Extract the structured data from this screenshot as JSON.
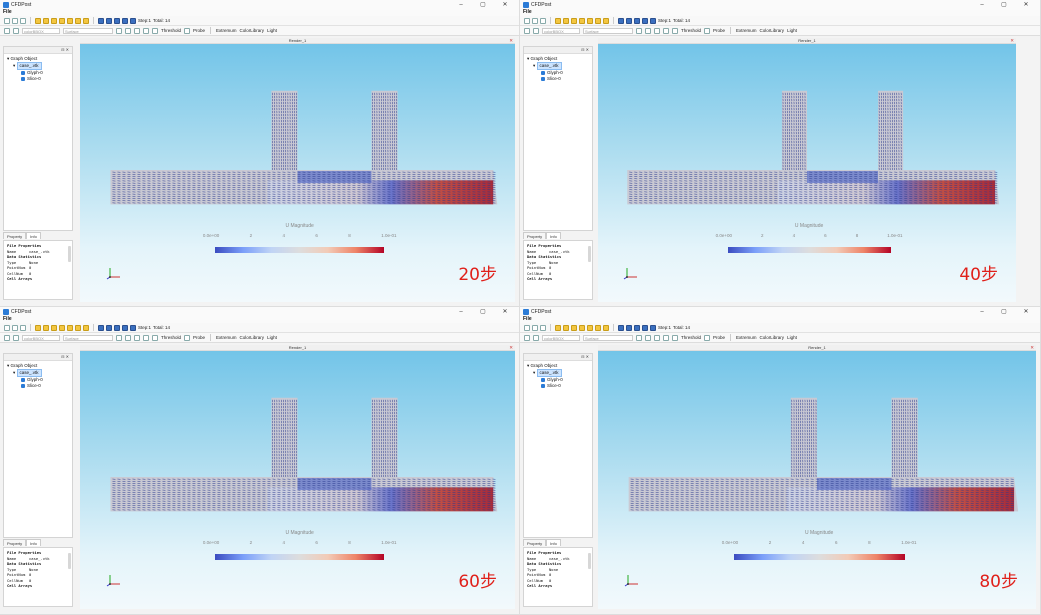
{
  "app": {
    "title": "CFDPost",
    "menu": "File",
    "window_buttons": [
      "–",
      "▢",
      "✕"
    ]
  },
  "toolbar": {
    "step_label": "Step:1",
    "total_label": "Total: 14",
    "threshold_label": "Threshold",
    "probe_label": "Probe",
    "extremum_label": "Extremum",
    "colorlibrary_label": "ColorLibrary",
    "light_label": "Light",
    "search_placeholder": "colorBBOX",
    "surface_placeholder": "Surface"
  },
  "panel": {
    "tree_root": "Graph Object",
    "tree_file": "case_.vtk",
    "tree_items": [
      "Glyph-0",
      "Slice-0"
    ],
    "tabs": [
      "Property",
      "Info"
    ],
    "props": {
      "section1": "File Properties",
      "name_key": "Name",
      "name_val": "case_.vtk",
      "section2": "Data Statistics",
      "type_key": "Type",
      "type_val": "None",
      "points_key": "PointNum",
      "points_val": "0",
      "cells_key": "CellNum",
      "cells_val": "0",
      "section3": "Cell Arrays"
    }
  },
  "viewport": {
    "title": "Render_1",
    "legend_title": "U Magnitude",
    "legend_ticks": [
      "0.0e+00",
      "2",
      "4",
      "6",
      "8",
      "1.0e-01"
    ]
  },
  "panes": [
    {
      "step_text": "20步"
    },
    {
      "step_text": "40步"
    },
    {
      "step_text": "60步"
    },
    {
      "step_text": "80步"
    }
  ],
  "colors": {
    "step_label": "#e0201a",
    "flow_low": "#3b4cc0",
    "flow_high": "#b40426"
  }
}
